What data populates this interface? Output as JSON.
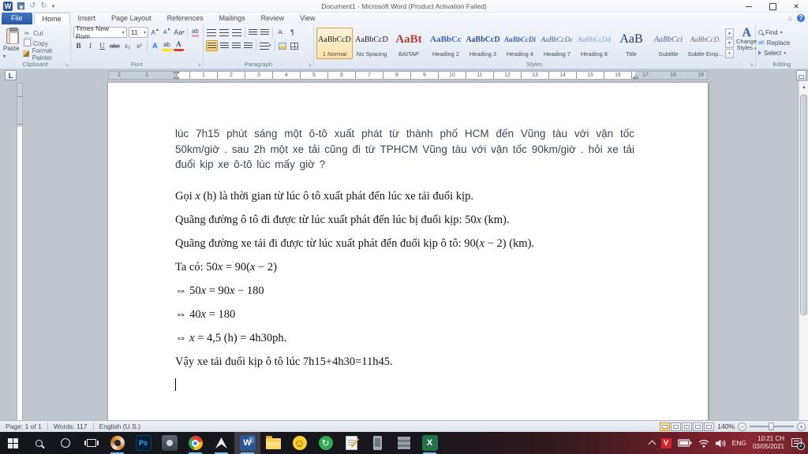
{
  "window": {
    "title": "Document1 - Microsoft Word (Product Activation Failed)"
  },
  "tabs": {
    "items": [
      "File",
      "Home",
      "Insert",
      "Page Layout",
      "References",
      "Mailings",
      "Review",
      "View"
    ],
    "active": "Home"
  },
  "ribbon": {
    "clipboard": {
      "label": "Clipboard",
      "paste": "Paste",
      "cut": "Cut",
      "copy": "Copy",
      "format_painter": "Format Painter"
    },
    "font": {
      "label": "Font",
      "family": "Times New Rom",
      "size": "11",
      "bold": "B",
      "italic": "I",
      "underline": "U",
      "strike": "abc",
      "subscript": "x₂",
      "superscript": "x²",
      "grow": "A",
      "shrink": "A",
      "change_case": "Aa",
      "effects": "A",
      "highlight": "ab",
      "color": "A"
    },
    "paragraph": {
      "label": "Paragraph",
      "sort": "A↓",
      "pilcrow": "¶"
    },
    "styles": {
      "label": "Styles",
      "change": "Change Styles",
      "change_glyph": "A",
      "items": [
        {
          "sample": "AaBbCcD",
          "name": "1 Normal",
          "selected": true
        },
        {
          "sample": "AaBbCcD",
          "name": "No Spacing"
        },
        {
          "sample": "AaBt",
          "name": "BAITAP"
        },
        {
          "sample": "AaBbCc",
          "name": "Heading 2"
        },
        {
          "sample": "AaBbCcD",
          "name": "Heading 3"
        },
        {
          "sample": "AaBbCcDi",
          "name": "Heading 4"
        },
        {
          "sample": "AaBbCcDc",
          "name": "Heading 7"
        },
        {
          "sample": "AaBbCcDd",
          "name": "Heading 8"
        },
        {
          "sample": "AaB",
          "name": "Title"
        },
        {
          "sample": "AaBbCci",
          "name": "Subtitle"
        },
        {
          "sample": "AaBbCcD.",
          "name": "Subtle Emp..."
        }
      ]
    },
    "editing": {
      "label": "Editing",
      "find": "Find",
      "replace": "Replace",
      "select": "Select"
    }
  },
  "ruler": {
    "tab_selector": "L",
    "left_margin_numbers": [
      "2",
      "1"
    ],
    "numbers": [
      "1",
      "2",
      "3",
      "4",
      "5",
      "6",
      "7",
      "8",
      "9",
      "10",
      "11",
      "12",
      "13",
      "14",
      "15",
      "16"
    ],
    "right_margin_numbers": [
      "17",
      "18",
      "19"
    ]
  },
  "document": {
    "problem": "lúc 7h15 phút sáng một ô-tô xuất phát từ thành phố HCM đến Vũng tàu với vận tốc 50km/giờ . sau 2h một xe tải cũng đi từ TPHCM Vũng tàu với vận tốc 90km/giờ . hỏi xe tải đuổi kịp xe ô-tô lúc mấy giờ ?",
    "solution_lines": [
      "Gọi x (h) là thời gian từ lúc ô tô xuất phát đến lúc xe tải đuổi kịp.",
      "Quãng đường ô tô đi được từ lúc xuất phát đến lúc bị đuổi kịp: 50x (km).",
      "Quãng đường xe tải đi được từ lúc xuất phát đến đuổi kịp ô tô: 90(x − 2) (km).",
      "Ta có: 50x = 90(x − 2)",
      "⇔ 50x = 90x − 180",
      "⇔ 40x = 180",
      "⇔ x = 4,5 (h) = 4h30ph.",
      "Vậy xe tải đuổi kịp ô tô lúc 7h15+4h30=11h45."
    ]
  },
  "status_bar": {
    "page": "Page: 1 of 1",
    "words": "Words: 117",
    "language": "English (U.S.)",
    "zoom": "140%",
    "zoom_out": "−",
    "zoom_in": "+"
  },
  "taskbar": {
    "apps": [
      {
        "name": "paint-app",
        "open": true
      },
      {
        "name": "photoshop",
        "glyph": "Ps",
        "open": false
      },
      {
        "name": "steam",
        "open": false
      },
      {
        "name": "chrome",
        "open": true
      },
      {
        "name": "foobar2000",
        "open": true
      },
      {
        "name": "word",
        "glyph": "W",
        "open": true,
        "active": true
      },
      {
        "name": "file-explorer",
        "open": false
      },
      {
        "name": "smiley-app",
        "glyph": "☺",
        "open": false
      },
      {
        "name": "green-downloader",
        "glyph": "↻",
        "open": false
      },
      {
        "name": "notepad",
        "open": false
      },
      {
        "name": "mobile-device",
        "open": false
      },
      {
        "name": "archive-app",
        "open": false
      },
      {
        "name": "excel",
        "glyph": "X",
        "open": true
      }
    ],
    "tray": {
      "unikey": "V",
      "language": "ENG",
      "time": "10:21 CH",
      "date": "03/05/2021",
      "badge": "2"
    }
  }
}
